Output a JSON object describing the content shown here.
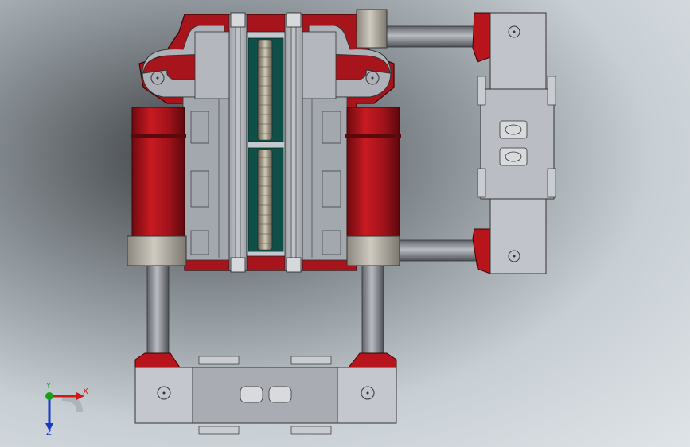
{
  "viewport": {
    "background_colors": {
      "dark": "#3a3d40",
      "light": "#dfe4e8"
    }
  },
  "model": {
    "colors": {
      "frame_red": "#b8141c",
      "frame_red_dark": "#7a0c10",
      "steel_gray": "#a9adb5",
      "steel_gray_light": "#c6c9cf",
      "steel_gray_dark": "#6f737a",
      "tube_gray": "#8d9096",
      "collar_tan": "#b7b2a8",
      "belt_teal": "#0e4f47",
      "roller": "#a8a190",
      "outline": "#2a2a2a"
    }
  },
  "triad": {
    "x_label": "X",
    "y_label": "Y",
    "z_label": "Z",
    "colors": {
      "x": "#d01818",
      "y": "#18a018",
      "z": "#1838c8"
    }
  }
}
